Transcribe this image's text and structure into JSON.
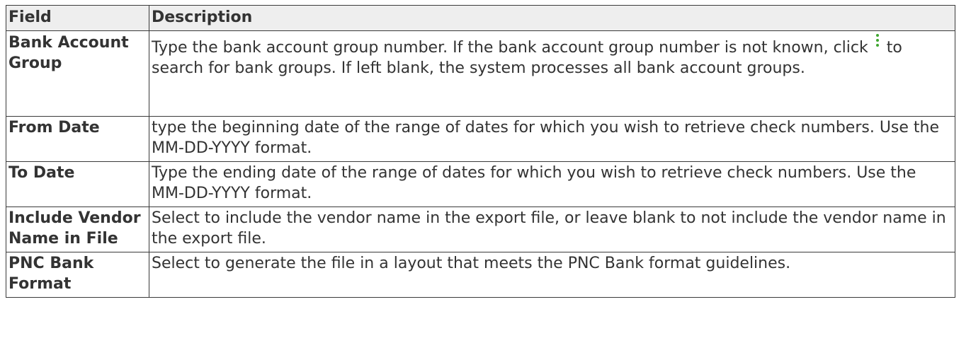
{
  "table": {
    "headers": {
      "field": "Field",
      "description": "Description"
    },
    "rows": [
      {
        "field": "Bank Account Group",
        "description_before_icon": "Type the bank account group number. If the bank account group number is not known, click",
        "icon": "kebab-icon",
        "description_after_icon": "to search for bank groups. If left blank, the system processes all bank account groups."
      },
      {
        "field": "From Date",
        "description": "type the beginning date of the range of dates for which you wish to retrieve check numbers. Use the MM-DD-YYYY format."
      },
      {
        "field": "To Date",
        "description": "Type the ending date of the range of dates for which you wish to retrieve check numbers. Use the MM-DD-YYYY format."
      },
      {
        "field": "Include Vendor Name in File",
        "description": "Select to include the vendor name in the export file, or leave blank to not include the vendor name in the export file."
      },
      {
        "field": "PNC Bank Format",
        "description": "Select to generate the file in a layout that meets the PNC Bank format guidelines."
      }
    ]
  },
  "colors": {
    "border": "#3a3a3a",
    "header_bg": "#eeeeee",
    "text": "#333333",
    "icon_green": "#3ea62f"
  }
}
